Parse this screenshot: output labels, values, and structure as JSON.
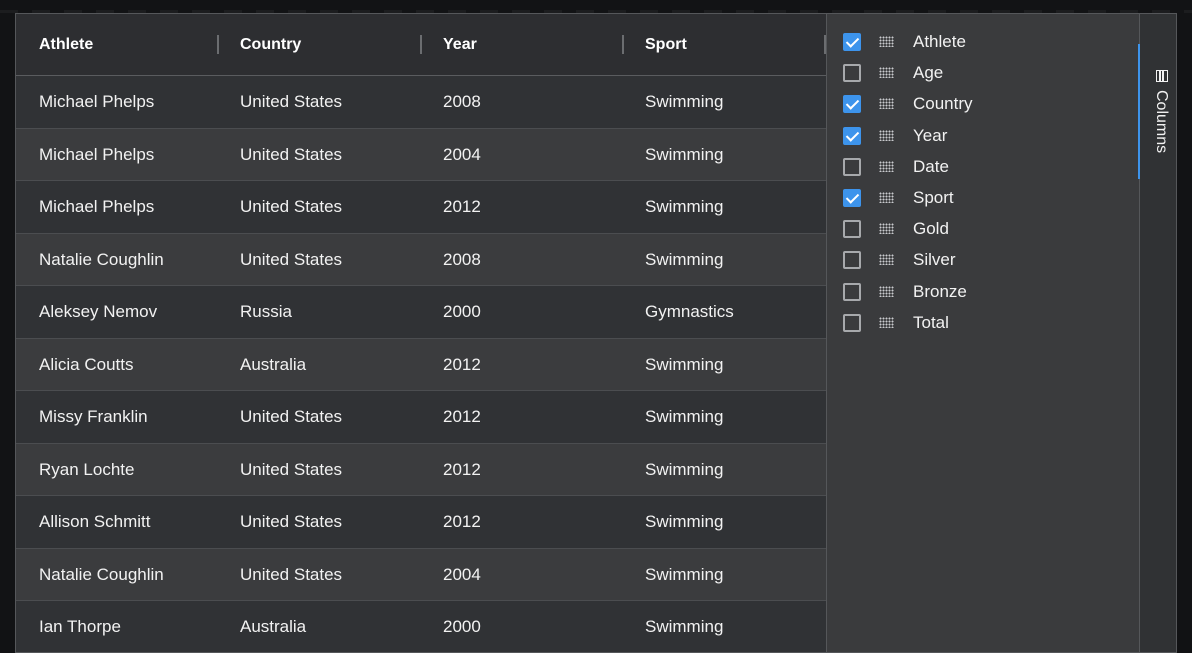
{
  "header": {
    "columns": [
      "Athlete",
      "Country",
      "Year",
      "Sport"
    ]
  },
  "rows": [
    [
      "Michael Phelps",
      "United States",
      "2008",
      "Swimming"
    ],
    [
      "Michael Phelps",
      "United States",
      "2004",
      "Swimming"
    ],
    [
      "Michael Phelps",
      "United States",
      "2012",
      "Swimming"
    ],
    [
      "Natalie Coughlin",
      "United States",
      "2008",
      "Swimming"
    ],
    [
      "Aleksey Nemov",
      "Russia",
      "2000",
      "Gymnastics"
    ],
    [
      "Alicia Coutts",
      "Australia",
      "2012",
      "Swimming"
    ],
    [
      "Missy Franklin",
      "United States",
      "2012",
      "Swimming"
    ],
    [
      "Ryan Lochte",
      "United States",
      "2012",
      "Swimming"
    ],
    [
      "Allison Schmitt",
      "United States",
      "2012",
      "Swimming"
    ],
    [
      "Natalie Coughlin",
      "United States",
      "2004",
      "Swimming"
    ],
    [
      "Ian Thorpe",
      "Australia",
      "2000",
      "Swimming"
    ]
  ],
  "columns_panel": {
    "items": [
      {
        "label": "Athlete",
        "checked": true
      },
      {
        "label": "Age",
        "checked": false
      },
      {
        "label": "Country",
        "checked": true
      },
      {
        "label": "Year",
        "checked": true
      },
      {
        "label": "Date",
        "checked": false
      },
      {
        "label": "Sport",
        "checked": true
      },
      {
        "label": "Gold",
        "checked": false
      },
      {
        "label": "Silver",
        "checked": false
      },
      {
        "label": "Bronze",
        "checked": false
      },
      {
        "label": "Total",
        "checked": false
      }
    ]
  },
  "side_bar": {
    "tab_label": "Columns",
    "tab_icon": "columns-icon"
  },
  "colors": {
    "accent": "#3d94ec",
    "row_odd": "#303235",
    "row_even": "#3b3c3e",
    "header_bg": "#2d2e31"
  }
}
